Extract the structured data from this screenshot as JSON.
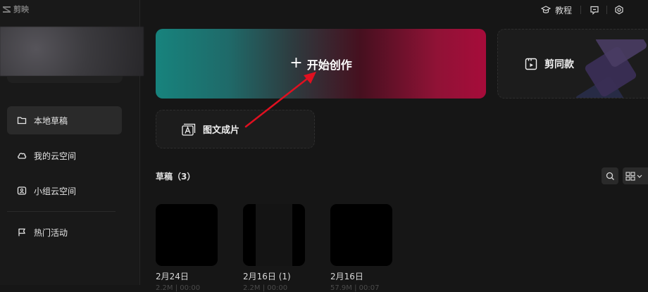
{
  "app": {
    "name": "剪映"
  },
  "topbar": {
    "tutorial": "教程"
  },
  "sidebar": {
    "items": [
      {
        "label": "本地草稿",
        "icon": "folder-icon"
      },
      {
        "label": "我的云空间",
        "icon": "cloud-icon"
      },
      {
        "label": "小组云空间",
        "icon": "group-cloud-icon"
      },
      {
        "label": "热门活动",
        "icon": "flag-icon"
      }
    ]
  },
  "main": {
    "start_label": "开始创作",
    "template_label": "剪同款",
    "text_to_video_label": "图文成片",
    "drafts_title": "草稿（3）",
    "drafts": [
      {
        "date": "2月24日",
        "sub": "2.2M | 00:00"
      },
      {
        "date": "2月16日 (1)",
        "sub": "2.2M | 00:00"
      },
      {
        "date": "2月16日",
        "sub": "57.9M | 00:07"
      }
    ]
  },
  "colors": {
    "accent_red": "#e01020",
    "start_left": "#17837d",
    "start_right": "#a60c3a"
  }
}
